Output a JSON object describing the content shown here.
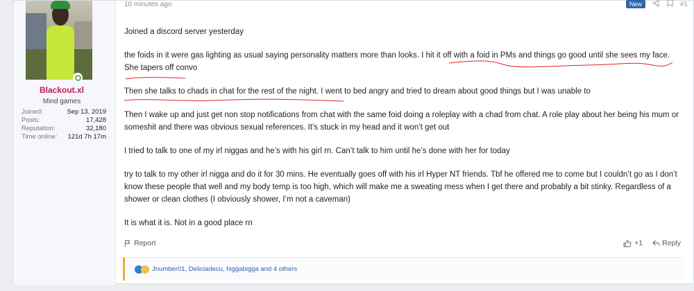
{
  "post": {
    "time": "10 minutes ago",
    "badge": "New",
    "number": "#1",
    "paragraphs": [
      "Joined a discord server yesterday",
      "the foids in it were gas lighting as usual saying personality matters more than looks. I hit it off with a foid in PMs and things go good until she sees my face. She tapers off convo",
      "Then she talks to chads in chat for the rest of the night. I went to bed angry and tried to dream about good things but I was unable to",
      "Then I wake up and just get non stop notifications from chat with the same foid doing a roleplay with a chad from chat. A role play about her being his mum or someshit and there was obvious sexual references. It’s stuck in my head and it won’t get out",
      "I tried to talk to one of my irl niggas and he’s with his girl rn. Can’t talk to him until he’s done with her for today",
      "try to talk to my other irl nigga and do it for 30 mins. He eventually goes off with his irl Hyper NT friends. Tbf he offered me to come but I couldn’t go as I don’t know these people that well and my body temp is too high, which will make me a sweating mess when I get there and probably a bit stinky. Regardless of a shower or clean clothes (I obviously shower, I’m not a caveman)",
      "It is what it is. Not in a good place rn"
    ],
    "report_label": "Report",
    "reaction_count": "+1",
    "reply_label": "Reply",
    "reactions_text": "Jnumber01, Deliciadecu, higgabigga and 4 others"
  },
  "user": {
    "name": "Blackout.xl",
    "title": "Mind games",
    "stats": [
      {
        "label": "Joined:",
        "value": "Sep 13, 2019"
      },
      {
        "label": "Posts:",
        "value": "17,428"
      },
      {
        "label": "Reputation:",
        "value": "32,180"
      },
      {
        "label": "Time online:",
        "value": "121d 7h 17m"
      }
    ]
  },
  "colors": {
    "username": "#c2185b",
    "accent": "#2f64a8",
    "annotation": "#e02020",
    "reaction_bar": "#f0a93b"
  },
  "icons": [
    "share-icon",
    "bookmark-icon",
    "report-icon",
    "like-icon",
    "reply-icon",
    "like-reaction-icon",
    "sad-reaction-icon"
  ]
}
